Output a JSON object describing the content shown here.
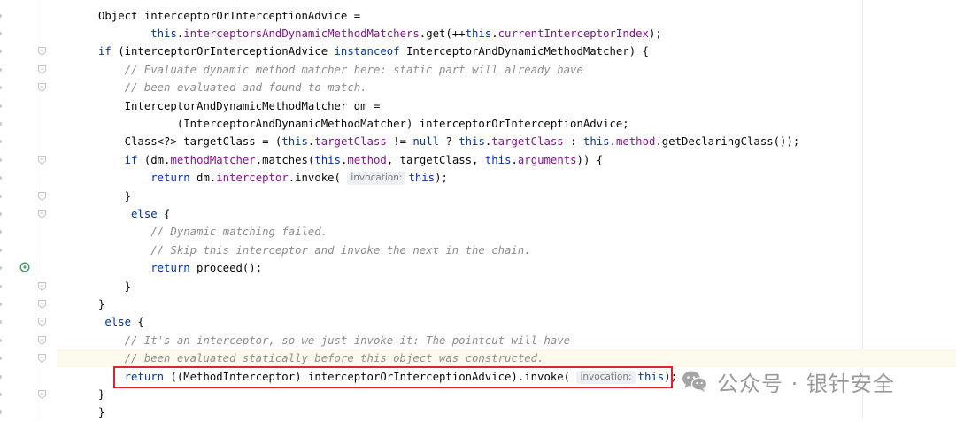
{
  "code": {
    "lines": [
      [
        {
          "t": "Object interceptorOrInterceptionAdvice =",
          "c": ""
        }
      ],
      [
        {
          "t": "        ",
          "c": ""
        },
        {
          "t": "this",
          "c": "kw"
        },
        {
          "t": ".",
          "c": ""
        },
        {
          "t": "interceptorsAndDynamicMethodMatchers",
          "c": "fld"
        },
        {
          "t": ".get(++",
          "c": ""
        },
        {
          "t": "this",
          "c": "kw"
        },
        {
          "t": ".",
          "c": ""
        },
        {
          "t": "currentInterceptorIndex",
          "c": "fld"
        },
        {
          "t": ");",
          "c": ""
        }
      ],
      [
        {
          "t": "if",
          "c": "kw"
        },
        {
          "t": " (interceptorOrInterceptionAdvice ",
          "c": ""
        },
        {
          "t": "instanceof",
          "c": "kw"
        },
        {
          "t": " InterceptorAndDynamicMethodMatcher) {",
          "c": ""
        }
      ],
      [
        {
          "t": "    // Evaluate dynamic method matcher here: static part will already have",
          "c": "cmt"
        }
      ],
      [
        {
          "t": "    // been evaluated and found to match.",
          "c": "cmt"
        }
      ],
      [
        {
          "t": "    InterceptorAndDynamicMethodMatcher dm =",
          "c": ""
        }
      ],
      [
        {
          "t": "            (InterceptorAndDynamicMethodMatcher) interceptorOrInterceptionAdvice;",
          "c": ""
        }
      ],
      [
        {
          "t": "    Class<?> targetClass = (",
          "c": ""
        },
        {
          "t": "this",
          "c": "kw"
        },
        {
          "t": ".",
          "c": ""
        },
        {
          "t": "targetClass",
          "c": "fld"
        },
        {
          "t": " != ",
          "c": ""
        },
        {
          "t": "null",
          "c": "kw"
        },
        {
          "t": " ? ",
          "c": ""
        },
        {
          "t": "this",
          "c": "kw"
        },
        {
          "t": ".",
          "c": ""
        },
        {
          "t": "targetClass",
          "c": "fld"
        },
        {
          "t": " : ",
          "c": ""
        },
        {
          "t": "this",
          "c": "kw"
        },
        {
          "t": ".",
          "c": ""
        },
        {
          "t": "method",
          "c": "fld"
        },
        {
          "t": ".getDeclaringClass());",
          "c": ""
        }
      ],
      [
        {
          "t": "    ",
          "c": ""
        },
        {
          "t": "if",
          "c": "kw"
        },
        {
          "t": " (dm.",
          "c": ""
        },
        {
          "t": "methodMatcher",
          "c": "fld"
        },
        {
          "t": ".matches(",
          "c": ""
        },
        {
          "t": "this",
          "c": "kw"
        },
        {
          "t": ".",
          "c": ""
        },
        {
          "t": "method",
          "c": "fld"
        },
        {
          "t": ", targetClass, ",
          "c": ""
        },
        {
          "t": "this",
          "c": "kw"
        },
        {
          "t": ".",
          "c": ""
        },
        {
          "t": "arguments",
          "c": "fld"
        },
        {
          "t": ")) {",
          "c": ""
        }
      ],
      [
        {
          "t": "        ",
          "c": ""
        },
        {
          "t": "return",
          "c": "kw"
        },
        {
          "t": " dm.",
          "c": ""
        },
        {
          "t": "interceptor",
          "c": "fld"
        },
        {
          "t": ".invoke( ",
          "c": ""
        },
        {
          "t": "invocation:",
          "c": "hint"
        },
        {
          "t": "this",
          "c": "kw"
        },
        {
          "t": ");",
          "c": ""
        }
      ],
      [
        {
          "t": "    }",
          "c": ""
        }
      ],
      [
        {
          "t": "     ",
          "c": ""
        },
        {
          "t": "else",
          "c": "kw"
        },
        {
          "t": " {",
          "c": ""
        }
      ],
      [
        {
          "t": "        // Dynamic matching failed.",
          "c": "cmt"
        }
      ],
      [
        {
          "t": "        // Skip this interceptor and invoke the next in the chain.",
          "c": "cmt"
        }
      ],
      [
        {
          "t": "        ",
          "c": ""
        },
        {
          "t": "return",
          "c": "kw"
        },
        {
          "t": " proceed();",
          "c": ""
        }
      ],
      [
        {
          "t": "    }",
          "c": ""
        }
      ],
      [
        {
          "t": "}",
          "c": ""
        }
      ],
      [
        {
          "t": " ",
          "c": ""
        },
        {
          "t": "else",
          "c": "kw"
        },
        {
          "t": " {",
          "c": ""
        }
      ],
      [
        {
          "t": "    // It's an interceptor, so we just invoke it: The pointcut will have",
          "c": "cmt"
        }
      ],
      [
        {
          "t": "    // been evaluated statically before this object was constructed.",
          "c": "cmt"
        }
      ],
      [
        {
          "t": "    ",
          "c": ""
        },
        {
          "t": "return",
          "c": "kw"
        },
        {
          "t": " ((MethodInterceptor) interceptorOrInterceptionAdvice).invoke( ",
          "c": ""
        },
        {
          "t": "invocation:",
          "c": "hint"
        },
        {
          "t": "this",
          "c": "kw"
        },
        {
          "t": ");",
          "c": ""
        }
      ],
      [
        {
          "t": "}",
          "c": ""
        }
      ],
      [
        {
          "t": "}",
          "c": ""
        }
      ]
    ],
    "highlighted_line": 19
  },
  "watermark": {
    "text": "公众号 · 银针安全",
    "icon": "wechat-icon"
  },
  "colors": {
    "keyword": "#0033b3",
    "field": "#871094",
    "comment": "#8c8c8c",
    "highlight_box": "#e0242b"
  }
}
